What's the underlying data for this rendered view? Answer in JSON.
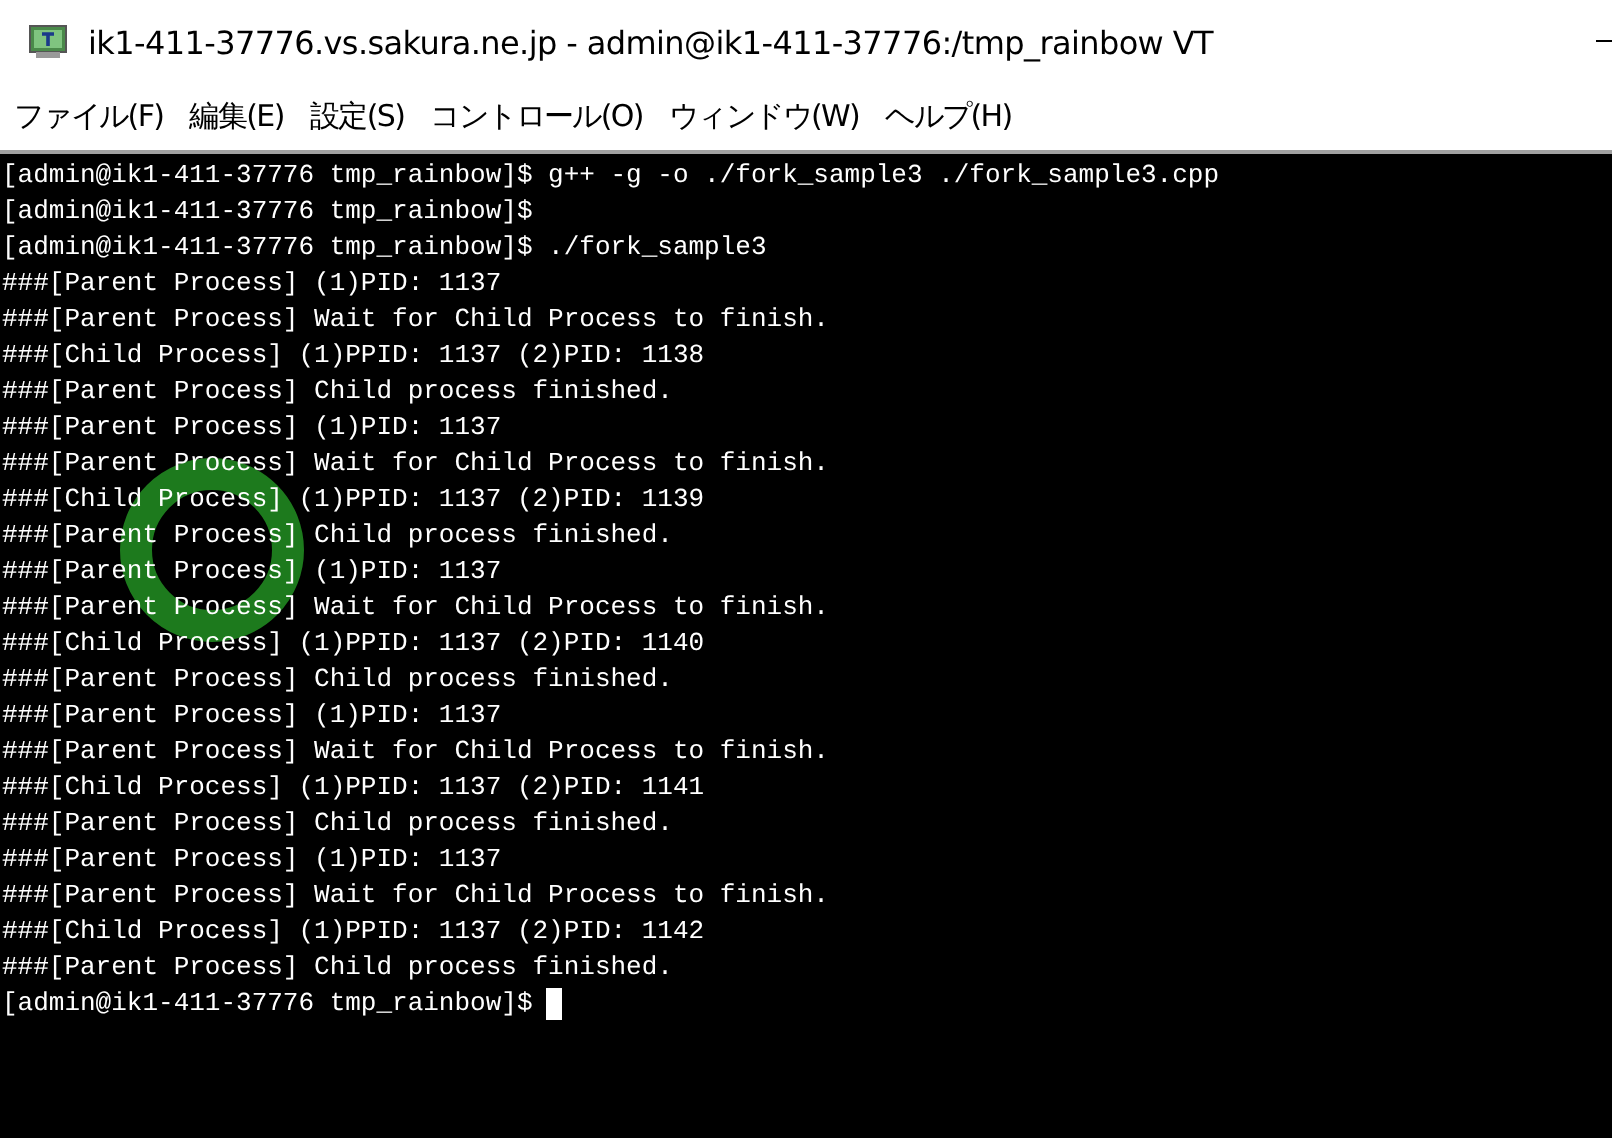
{
  "window": {
    "title": "ik1-411-37776.vs.sakura.ne.jp - admin@ik1-411-37776:/tmp_rainbow VT"
  },
  "menu": [
    "ファイル(F)",
    "編集(E)",
    "設定(S)",
    "コントロール(O)",
    "ウィンドウ(W)",
    "ヘルプ(H)"
  ],
  "terminal": {
    "lines": [
      "[admin@ik1-411-37776 tmp_rainbow]$ g++ -g -o ./fork_sample3 ./fork_sample3.cpp",
      "[admin@ik1-411-37776 tmp_rainbow]$",
      "[admin@ik1-411-37776 tmp_rainbow]$ ./fork_sample3",
      "###[Parent Process] (1)PID: 1137",
      "###[Parent Process] Wait for Child Process to finish.",
      "###[Child Process] (1)PPID: 1137 (2)PID: 1138",
      "###[Parent Process] Child process finished.",
      "###[Parent Process] (1)PID: 1137",
      "###[Parent Process] Wait for Child Process to finish.",
      "###[Child Process] (1)PPID: 1137 (2)PID: 1139",
      "###[Parent Process] Child process finished.",
      "###[Parent Process] (1)PID: 1137",
      "###[Parent Process] Wait for Child Process to finish.",
      "###[Child Process] (1)PPID: 1137 (2)PID: 1140",
      "###[Parent Process] Child process finished.",
      "###[Parent Process] (1)PID: 1137",
      "###[Parent Process] Wait for Child Process to finish.",
      "###[Child Process] (1)PPID: 1137 (2)PID: 1141",
      "###[Parent Process] Child process finished.",
      "###[Parent Process] (1)PID: 1137",
      "###[Parent Process] Wait for Child Process to finish.",
      "###[Child Process] (1)PPID: 1137 (2)PID: 1142",
      "###[Parent Process] Child process finished."
    ],
    "prompt": "[admin@ik1-411-37776 tmp_rainbow]$",
    "cursor_visible": true
  }
}
